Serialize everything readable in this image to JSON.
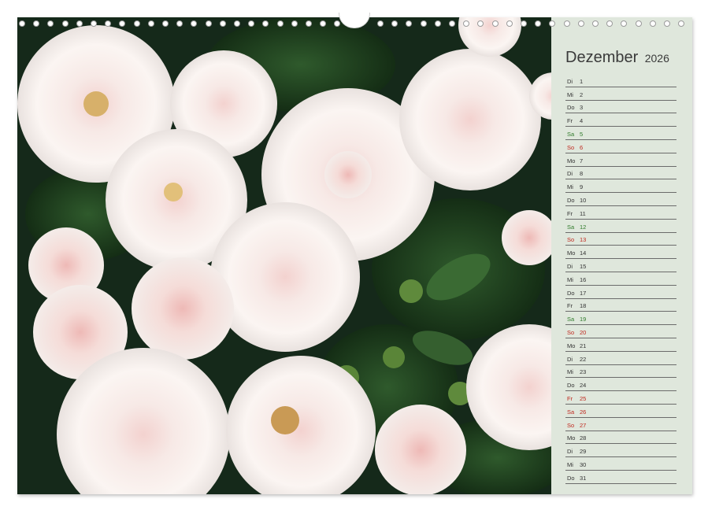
{
  "calendar": {
    "month": "Dezember",
    "year": "2026",
    "days": [
      {
        "wd": "Di",
        "d": "1",
        "type": "weekday"
      },
      {
        "wd": "Mi",
        "d": "2",
        "type": "weekday"
      },
      {
        "wd": "Do",
        "d": "3",
        "type": "weekday"
      },
      {
        "wd": "Fr",
        "d": "4",
        "type": "weekday"
      },
      {
        "wd": "Sa",
        "d": "5",
        "type": "sat"
      },
      {
        "wd": "So",
        "d": "6",
        "type": "sun"
      },
      {
        "wd": "Mo",
        "d": "7",
        "type": "weekday"
      },
      {
        "wd": "Di",
        "d": "8",
        "type": "weekday"
      },
      {
        "wd": "Mi",
        "d": "9",
        "type": "weekday"
      },
      {
        "wd": "Do",
        "d": "10",
        "type": "weekday"
      },
      {
        "wd": "Fr",
        "d": "11",
        "type": "weekday"
      },
      {
        "wd": "Sa",
        "d": "12",
        "type": "sat"
      },
      {
        "wd": "So",
        "d": "13",
        "type": "sun"
      },
      {
        "wd": "Mo",
        "d": "14",
        "type": "weekday"
      },
      {
        "wd": "Di",
        "d": "15",
        "type": "weekday"
      },
      {
        "wd": "Mi",
        "d": "16",
        "type": "weekday"
      },
      {
        "wd": "Do",
        "d": "17",
        "type": "weekday"
      },
      {
        "wd": "Fr",
        "d": "18",
        "type": "weekday"
      },
      {
        "wd": "Sa",
        "d": "19",
        "type": "sat"
      },
      {
        "wd": "So",
        "d": "20",
        "type": "sun"
      },
      {
        "wd": "Mo",
        "d": "21",
        "type": "weekday"
      },
      {
        "wd": "Di",
        "d": "22",
        "type": "weekday"
      },
      {
        "wd": "Mi",
        "d": "23",
        "type": "weekday"
      },
      {
        "wd": "Do",
        "d": "24",
        "type": "weekday"
      },
      {
        "wd": "Fr",
        "d": "25",
        "type": "hol"
      },
      {
        "wd": "Sa",
        "d": "26",
        "type": "hol"
      },
      {
        "wd": "So",
        "d": "27",
        "type": "sun"
      },
      {
        "wd": "Mo",
        "d": "28",
        "type": "weekday"
      },
      {
        "wd": "Di",
        "d": "29",
        "type": "weekday"
      },
      {
        "wd": "Mi",
        "d": "30",
        "type": "weekday"
      },
      {
        "wd": "Do",
        "d": "31",
        "type": "weekday"
      }
    ]
  },
  "colors": {
    "panel_bg": "#dfe7dc",
    "saturday": "#2f7a2a",
    "sunday_holiday": "#c0281e",
    "text": "#333333"
  },
  "photo": {
    "subject-icon": "white-roses-photo"
  }
}
